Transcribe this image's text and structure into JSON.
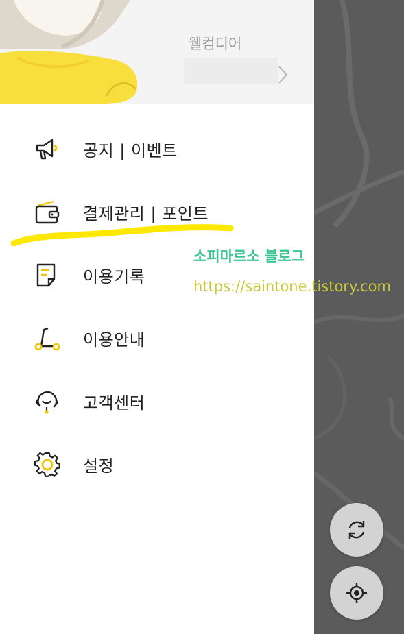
{
  "header": {
    "username": "웰컴디어"
  },
  "menu": [
    {
      "id": "notice",
      "label": "공지 | 이벤트",
      "icon": "megaphone-icon"
    },
    {
      "id": "payment",
      "label": "결제관리 | 포인트",
      "icon": "wallet-icon"
    },
    {
      "id": "history",
      "label": "이용기록",
      "icon": "document-icon"
    },
    {
      "id": "guide",
      "label": "이용안내",
      "icon": "scooter-icon"
    },
    {
      "id": "support",
      "label": "고객센터",
      "icon": "headset-icon"
    },
    {
      "id": "settings",
      "label": "설정",
      "icon": "gear-icon"
    }
  ],
  "watermark": {
    "line1": "소피마르소 블로그",
    "line2": "https://saintone.tistory.com"
  },
  "map_controls": {
    "refresh_icon": "refresh-icon",
    "locate_icon": "location-target-icon"
  },
  "colors": {
    "accent_yellow": "#f5c400",
    "highlighter": "#ffe800",
    "map_bg": "#5b5b5b",
    "watermark_green": "#39c78f"
  }
}
